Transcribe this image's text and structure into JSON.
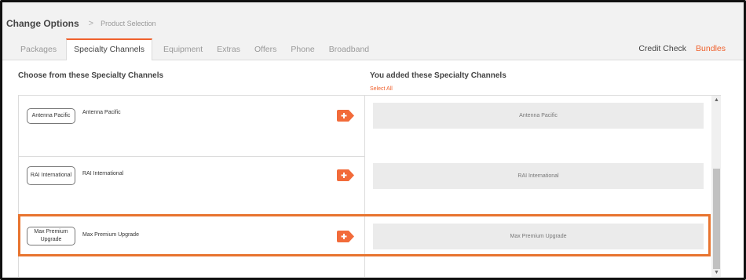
{
  "header": {
    "title": "Change Options",
    "separator": ">",
    "subtitle": "Product Selection"
  },
  "tabs": [
    {
      "label": "Packages",
      "active": false
    },
    {
      "label": "Specialty Channels",
      "active": true
    },
    {
      "label": "Equipment",
      "active": false
    },
    {
      "label": "Extras",
      "active": false
    },
    {
      "label": "Offers",
      "active": false
    },
    {
      "label": "Phone",
      "active": false
    },
    {
      "label": "Broadband",
      "active": false
    }
  ],
  "right_links": {
    "credit_check": "Credit Check",
    "bundles": "Bundles"
  },
  "left_panel": {
    "heading": "Choose from these Specialty Channels",
    "items": [
      {
        "box_label": "Antenna Pacific",
        "name": "Antenna Pacific"
      },
      {
        "box_label": "RAI International",
        "name": "RAI International"
      },
      {
        "box_label": "Max Premium Upgrade",
        "name": "Max Premium Upgrade"
      }
    ]
  },
  "right_panel": {
    "heading": "You added these Specialty Channels",
    "select_all": "Select All",
    "items": [
      "Antenna Pacific",
      "RAI International",
      "Max Premium Upgrade"
    ]
  },
  "icons": {
    "add": "plus-tag-icon",
    "chevron": "chevron-right-icon",
    "scroll_up": "triangle-up-icon",
    "scroll_down": "triangle-down-icon"
  },
  "colors": {
    "accent": "#f0612d",
    "highlight": "#e8742f",
    "add_button": "#f26b3a",
    "added_bg": "#ebebeb"
  }
}
